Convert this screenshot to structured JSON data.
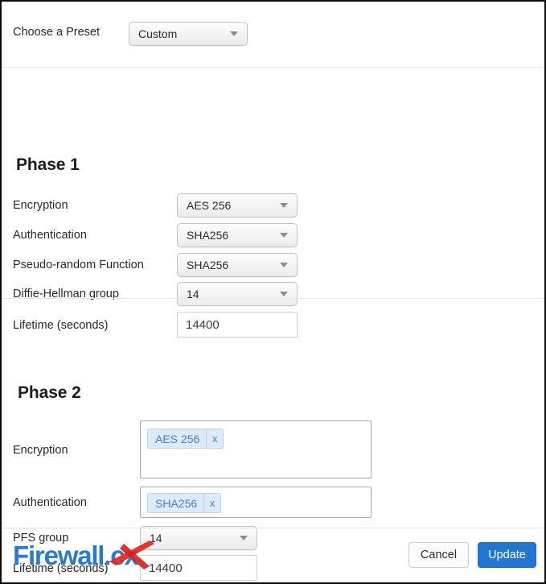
{
  "preset": {
    "label": "Choose a Preset",
    "value": "Custom",
    "caret_icon": "chevron-down-icon"
  },
  "phase1": {
    "heading": "Phase 1",
    "fields": [
      {
        "label": "Encryption",
        "value": "AES 256",
        "type": "select"
      },
      {
        "label": "Authentication",
        "value": "SHA256",
        "type": "select"
      },
      {
        "label": "Pseudo-random Function",
        "value": "SHA256",
        "type": "select"
      },
      {
        "label": "Diffie-Hellman group",
        "value": "14",
        "type": "select"
      },
      {
        "label": "Lifetime (seconds)",
        "value": "14400",
        "type": "text"
      }
    ]
  },
  "phase2": {
    "heading": "Phase 2",
    "encryption": {
      "label": "Encryption",
      "tokens": [
        {
          "label": "AES 256",
          "remove": "x"
        }
      ]
    },
    "authentication": {
      "label": "Authentication",
      "tokens": [
        {
          "label": "SHA256",
          "remove": "x"
        }
      ]
    },
    "pfs": {
      "label": "PFS group",
      "value": "14"
    },
    "lifetime": {
      "label": "Lifetime (seconds)",
      "value": "14400"
    }
  },
  "footer": {
    "logo_text_main": "Firewall.c",
    "logo_text_x": "x",
    "logo_name": "firewall-cx-logo",
    "cancel_label": "Cancel",
    "update_label": "Update"
  },
  "colors": {
    "accent_blue": "#2176d2",
    "logo_blue": "#2b7ad1",
    "logo_red": "#e32a26",
    "token_blue": "#4a7fc1",
    "token_bg": "#ddeaf8"
  }
}
